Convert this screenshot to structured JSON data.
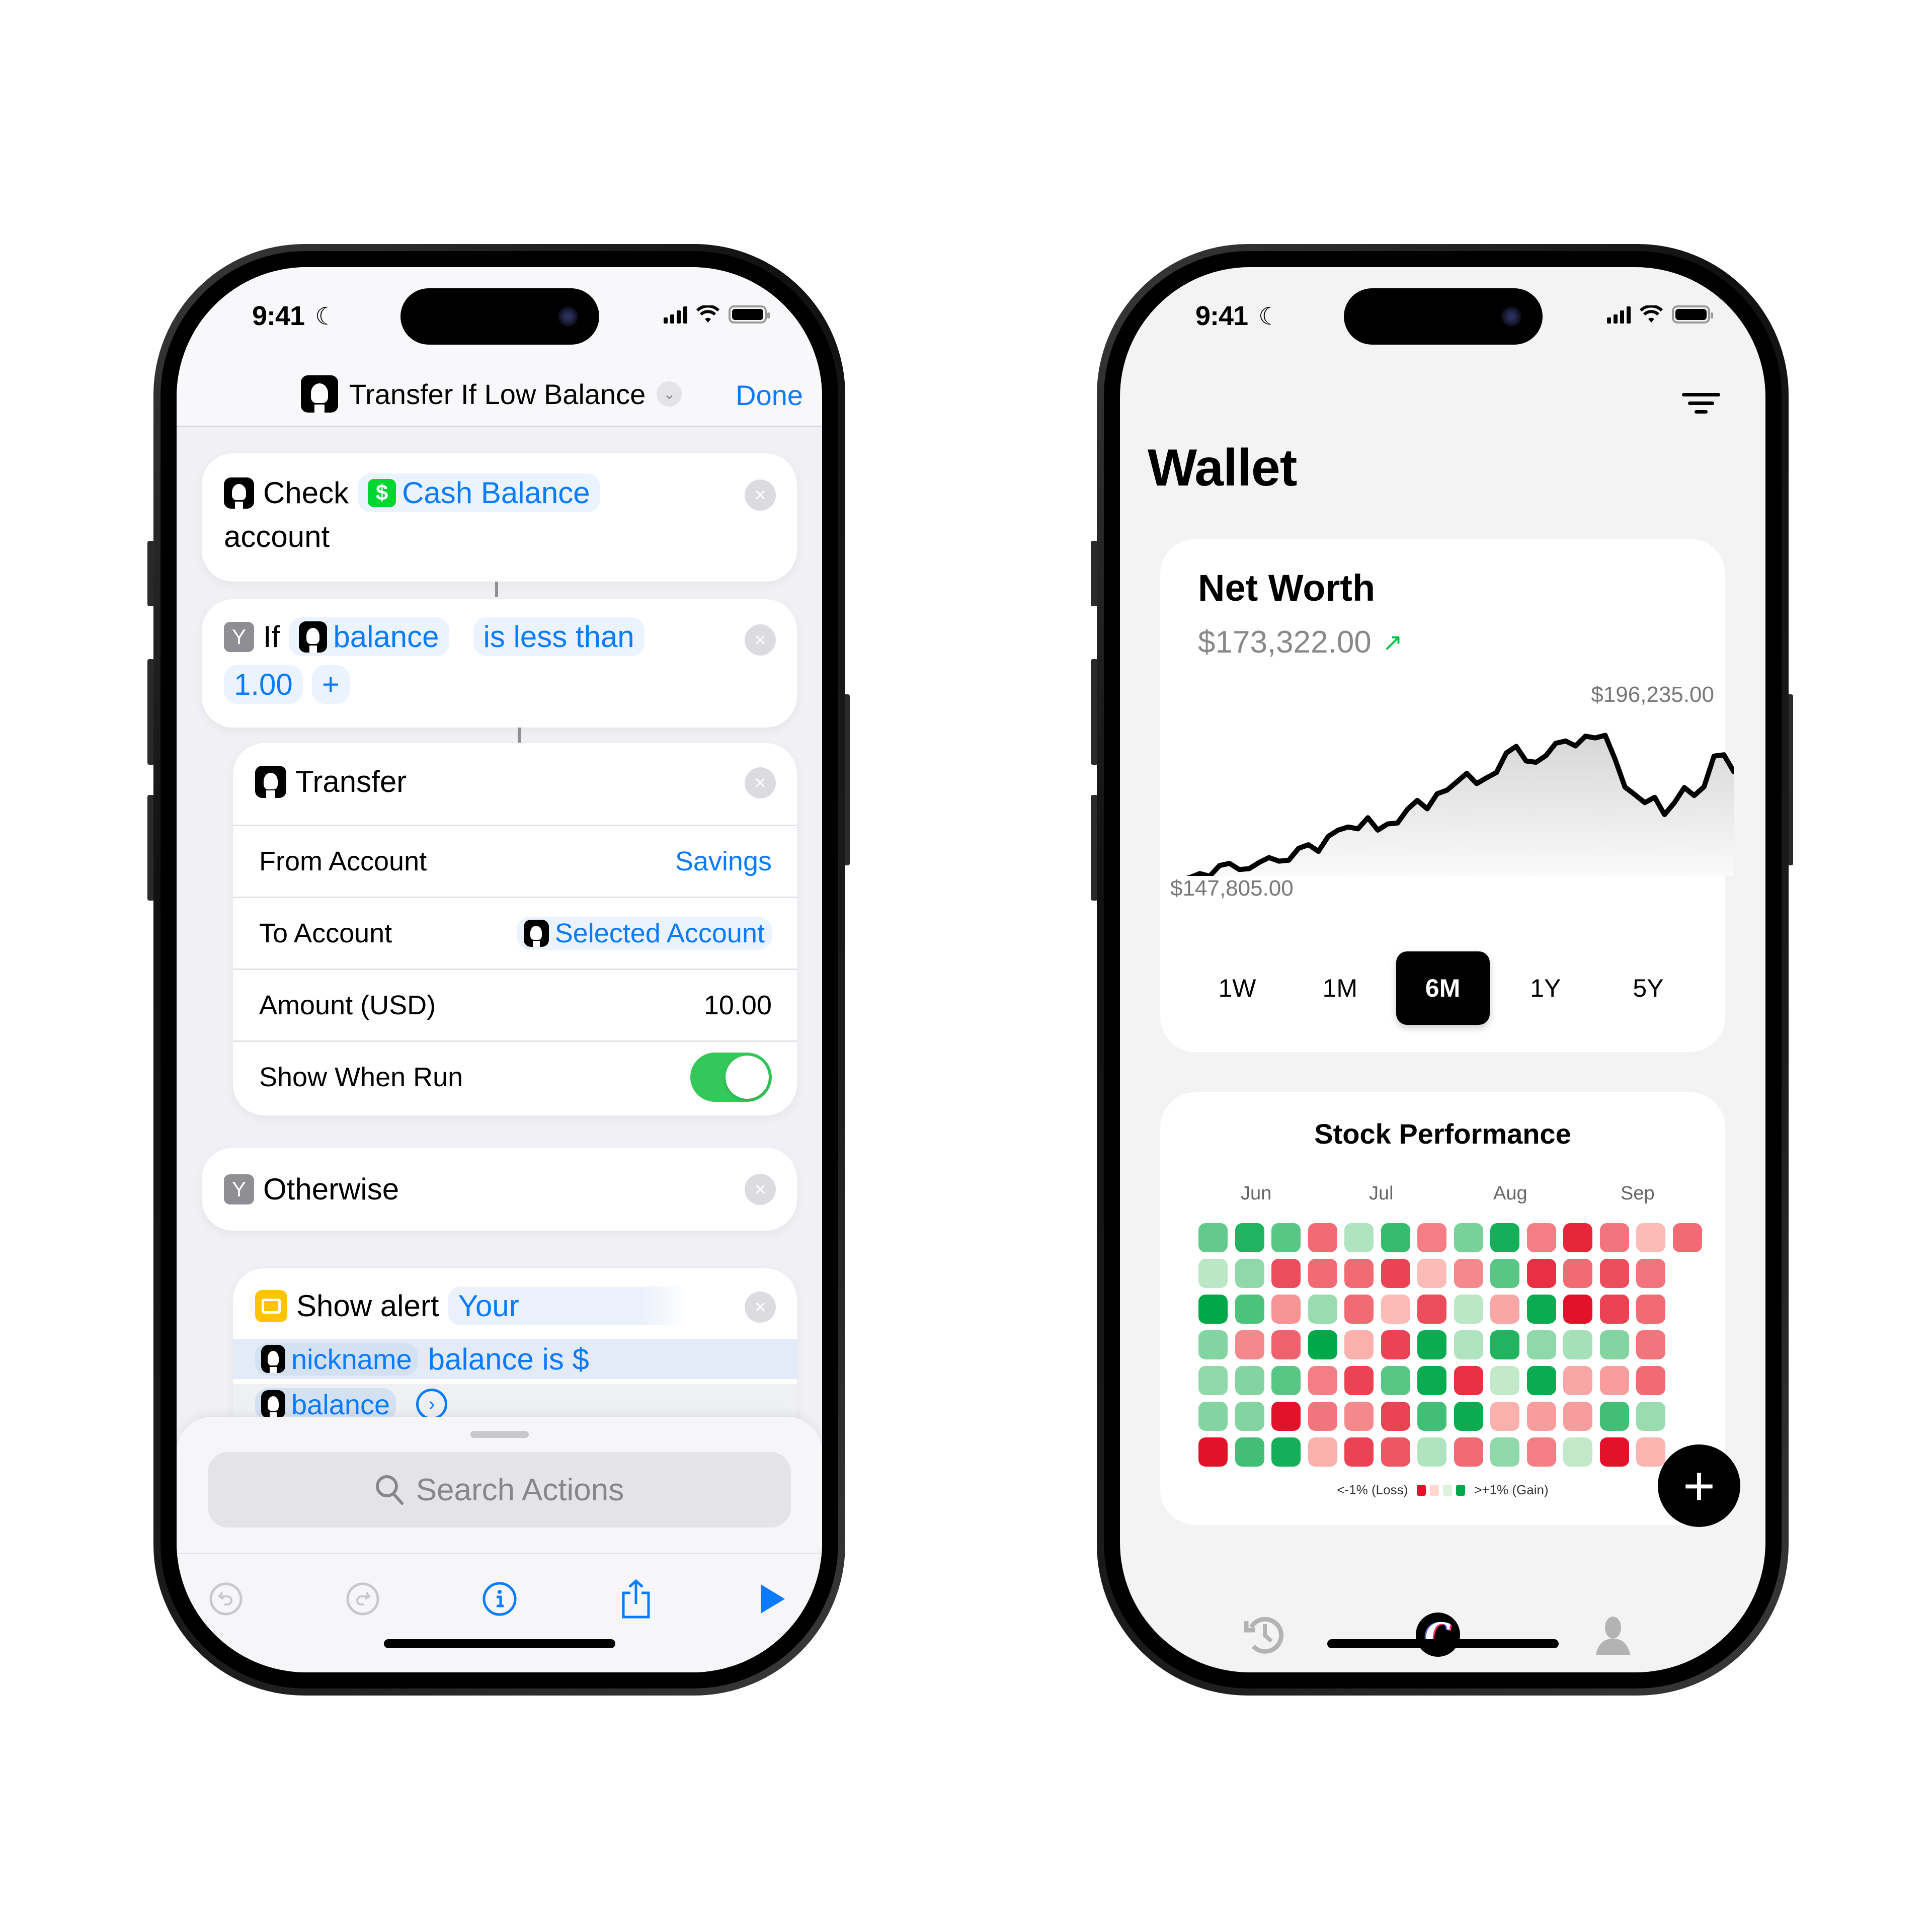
{
  "left_phone": {
    "status": {
      "time": "9:41",
      "focus_icon": "moon-icon"
    },
    "nav": {
      "title": "Transfer If Low Balance",
      "done_label": "Done"
    },
    "actions": {
      "check": {
        "verb": "Check",
        "token": "Cash Balance",
        "suffix": "account"
      },
      "if": {
        "keyword": "If",
        "variable": "balance",
        "condition": "is less than",
        "value": "1.00",
        "add_label": "+"
      },
      "transfer": {
        "title": "Transfer",
        "params": [
          {
            "label": "From Account",
            "value": "Savings"
          },
          {
            "label": "To Account",
            "value": "Selected Account"
          },
          {
            "label": "Amount (USD)",
            "value": "10.00"
          },
          {
            "label": "Show When Run",
            "value": "on"
          }
        ]
      },
      "otherwise": {
        "label": "Otherwise"
      },
      "alert": {
        "verb": "Show alert",
        "text1": "Your",
        "var1": "nickname",
        "text2": "balance is $",
        "var2": "balance"
      }
    },
    "search": {
      "placeholder": "Search Actions"
    },
    "toolbar": [
      "undo-icon",
      "redo-icon",
      "info-icon",
      "share-icon",
      "play-icon"
    ]
  },
  "right_phone": {
    "status": {
      "time": "9:41",
      "focus_icon": "moon-icon"
    },
    "title": "Wallet",
    "net_worth": {
      "title": "Net Worth",
      "value": "$173,322.00",
      "trend": "up",
      "max_label": "$196,235.00",
      "min_label": "$147,805.00"
    },
    "ranges": [
      {
        "label": "1W",
        "selected": false
      },
      {
        "label": "1M",
        "selected": false
      },
      {
        "label": "6M",
        "selected": true
      },
      {
        "label": "1Y",
        "selected": false
      },
      {
        "label": "5Y",
        "selected": false
      }
    ],
    "stock_performance": {
      "title": "Stock Performance",
      "months": [
        "Jun",
        "Jul",
        "Aug",
        "Sep"
      ],
      "legend_loss": "<-1% (Loss)",
      "legend_gain": ">+1% (Gain)"
    },
    "fab_label": "+",
    "tabs": [
      "history-icon",
      "app-logo-icon",
      "profile-icon"
    ]
  },
  "chart_data": [
    {
      "type": "area",
      "title": "Net Worth",
      "ylabel": "USD",
      "ylim": [
        147805,
        196235
      ],
      "series": [
        {
          "name": "Net Worth (6M)",
          "values": [
            150200,
            152600,
            153500,
            154100,
            155000,
            154400,
            156800,
            157300,
            155900,
            156100,
            157500,
            158600,
            157800,
            158000,
            160700,
            161500,
            160000,
            163400,
            164800,
            165500,
            165100,
            167600,
            164800,
            166200,
            166400,
            169500,
            171500,
            169600,
            173000,
            173800,
            175700,
            177600,
            175300,
            176600,
            177800,
            182200,
            183700,
            180400,
            180100,
            181600,
            184400,
            184900,
            183800,
            186000,
            185600,
            186200,
            180800,
            174500,
            172800,
            171000,
            172200,
            168300,
            171000,
            174400,
            172600,
            174600,
            181500,
            181800,
            178000
          ]
        }
      ]
    },
    {
      "type": "heatmap",
      "title": "Stock Performance",
      "x_labels": [
        "Jun",
        "Jul",
        "Aug",
        "Sep"
      ],
      "scale": [
        -1,
        1
      ],
      "rows": [
        [
          0.55,
          0.85,
          0.6,
          -0.55,
          0.2,
          0.75,
          -0.45,
          0.45,
          0.9,
          -0.45,
          -0.9,
          -0.5,
          -0.15,
          -0.55
        ],
        [
          0.15,
          0.35,
          -0.7,
          -0.55,
          -0.55,
          -0.75,
          -0.15,
          -0.4,
          0.6,
          -0.85,
          -0.55,
          -0.7,
          -0.5
        ],
        [
          1.0,
          0.65,
          -0.35,
          0.3,
          -0.55,
          -0.15,
          -0.7,
          0.15,
          -0.25,
          0.95,
          -1.0,
          -0.75,
          -0.55
        ],
        [
          0.4,
          -0.4,
          -0.6,
          1.0,
          -0.2,
          -0.75,
          0.95,
          0.2,
          0.85,
          0.35,
          0.25,
          0.4,
          -0.5
        ],
        [
          0.35,
          0.4,
          0.6,
          -0.45,
          -0.75,
          0.6,
          0.95,
          -0.85,
          0.12,
          0.95,
          -0.25,
          -0.3,
          -0.55
        ],
        [
          0.4,
          0.4,
          -1.0,
          -0.5,
          -0.4,
          -0.75,
          0.7,
          0.95,
          -0.2,
          -0.3,
          -0.3,
          0.7,
          0.3
        ],
        [
          -1.0,
          0.7,
          0.9,
          -0.2,
          -0.75,
          -0.65,
          0.2,
          -0.55,
          0.35,
          -0.45,
          0.12,
          -1.0,
          -0.18
        ]
      ]
    }
  ]
}
